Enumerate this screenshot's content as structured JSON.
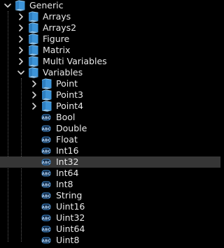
{
  "tree": {
    "colors": {
      "background": "#000000",
      "text": "#e8e8e8",
      "selection": "#363636",
      "folder_icon": "#3d94d8",
      "variable_icon": "#3d84c6",
      "guide_line": "#5a5a5a"
    },
    "rows": [
      {
        "label": "Generic",
        "depth": 0,
        "icon": "folder-icon",
        "expander": "expanded"
      },
      {
        "label": "Arrays",
        "depth": 1,
        "icon": "folder-icon",
        "expander": "collapsed"
      },
      {
        "label": "Arrays2",
        "depth": 1,
        "icon": "folder-icon",
        "expander": "collapsed"
      },
      {
        "label": "Figure",
        "depth": 1,
        "icon": "folder-icon",
        "expander": "collapsed"
      },
      {
        "label": "Matrix",
        "depth": 1,
        "icon": "folder-icon",
        "expander": "collapsed"
      },
      {
        "label": "Multi Variables",
        "depth": 1,
        "icon": "folder-icon",
        "expander": "collapsed"
      },
      {
        "label": "Variables",
        "depth": 1,
        "icon": "folder-icon",
        "expander": "expanded"
      },
      {
        "label": "Point",
        "depth": 2,
        "icon": "folder-icon",
        "expander": "collapsed"
      },
      {
        "label": "Point3",
        "depth": 2,
        "icon": "folder-icon",
        "expander": "collapsed"
      },
      {
        "label": "Point4",
        "depth": 2,
        "icon": "folder-icon",
        "expander": "collapsed"
      },
      {
        "label": "Bool",
        "depth": 2,
        "icon": "variable-icon",
        "expander": "none"
      },
      {
        "label": "Double",
        "depth": 2,
        "icon": "variable-icon",
        "expander": "none"
      },
      {
        "label": "Float",
        "depth": 2,
        "icon": "variable-icon",
        "expander": "none"
      },
      {
        "label": "Int16",
        "depth": 2,
        "icon": "variable-icon",
        "expander": "none"
      },
      {
        "label": "Int32",
        "depth": 2,
        "icon": "variable-icon",
        "expander": "none",
        "selected": true
      },
      {
        "label": "Int64",
        "depth": 2,
        "icon": "variable-icon",
        "expander": "none"
      },
      {
        "label": "Int8",
        "depth": 2,
        "icon": "variable-icon",
        "expander": "none"
      },
      {
        "label": "String",
        "depth": 2,
        "icon": "variable-icon",
        "expander": "none"
      },
      {
        "label": "Uint16",
        "depth": 2,
        "icon": "variable-icon",
        "expander": "none"
      },
      {
        "label": "Uint32",
        "depth": 2,
        "icon": "variable-icon",
        "expander": "none"
      },
      {
        "label": "Uint64",
        "depth": 2,
        "icon": "variable-icon",
        "expander": "none"
      },
      {
        "label": "Uint8",
        "depth": 2,
        "icon": "variable-icon",
        "expander": "none"
      }
    ]
  }
}
